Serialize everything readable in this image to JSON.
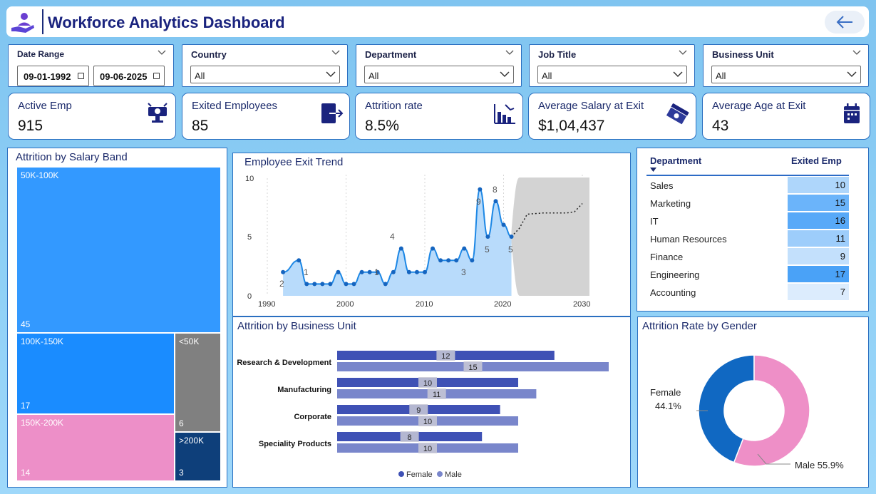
{
  "header": {
    "title": "Workforce Analytics Dashboard"
  },
  "filters": {
    "date_range": {
      "label": "Date Range",
      "start": "09-01-1992",
      "end": "09-06-2025"
    },
    "country": {
      "label": "Country",
      "value": "All"
    },
    "department": {
      "label": "Department",
      "value": "All"
    },
    "job_title": {
      "label": "Job Title",
      "value": "All"
    },
    "business_unit": {
      "label": "Business Unit",
      "value": "All"
    }
  },
  "kpis": [
    {
      "label": "Active Emp",
      "value": "915",
      "icon": "workstation-icon"
    },
    {
      "label": "Exited Employees",
      "value": "85",
      "icon": "exit-door-icon"
    },
    {
      "label": "Attrition rate",
      "value": "8.5%",
      "icon": "declining-chart-icon"
    },
    {
      "label": "Average Salary at Exit",
      "value": "$1,04,437",
      "icon": "money-stack-icon"
    },
    {
      "label": "Average Age at Exit",
      "value": "43",
      "icon": "calendar-icon"
    }
  ],
  "salary_band": {
    "title": "Attrition by Salary Band",
    "bands": [
      {
        "label": "50K-100K",
        "value": "45",
        "color": "#3399ff"
      },
      {
        "label": "100K-150K",
        "value": "17",
        "color": "#1a8cff"
      },
      {
        "label": "<50K",
        "value": "6",
        "color": "#808080"
      },
      {
        "label": "150K-200K",
        "value": "14",
        "color": "#ed8fc8"
      },
      {
        "label": ">200K",
        "value": "3",
        "color": "#0e3f7a"
      }
    ]
  },
  "exit_trend": {
    "title": "Employee Exit Trend",
    "y_ticks": [
      "10",
      "5",
      "0"
    ],
    "x_ticks": [
      "1990",
      "2000",
      "2010",
      "2020",
      "2030"
    ],
    "point_labels": [
      "2",
      "1",
      "1",
      "4",
      "3",
      "9",
      "8",
      "5",
      "5"
    ]
  },
  "business_unit": {
    "title": "Attrition by Business Unit",
    "legend": {
      "female": "Female",
      "male": "Male"
    },
    "colors": {
      "female": "#3f51b5",
      "male": "#7986cb"
    }
  },
  "department_table": {
    "header_dept": "Department",
    "header_exited": "Exited Emp",
    "rows": [
      {
        "name": "Sales",
        "value": "10",
        "color": "#aed6fb"
      },
      {
        "name": "Marketing",
        "value": "15",
        "color": "#6bb4fa"
      },
      {
        "name": "IT",
        "value": "16",
        "color": "#58a9f8"
      },
      {
        "name": "Human Resources",
        "value": "11",
        "color": "#9dcdfb"
      },
      {
        "name": "Finance",
        "value": "9",
        "color": "#c3e0fc"
      },
      {
        "name": "Engineering",
        "value": "17",
        "color": "#4aa2f7"
      },
      {
        "name": "Accounting",
        "value": "7",
        "color": "#dcecfd"
      }
    ]
  },
  "gender": {
    "title": "Attrition Rate by Gender",
    "female_label": "Female",
    "female_value": "44.1%",
    "male_label": "Male 55.9%",
    "colors": {
      "female": "#1068c2",
      "male": "#ee8fc7"
    }
  },
  "chart_data": [
    {
      "type": "line",
      "title": "Employee Exit Trend",
      "x": [
        1992,
        1994,
        1995,
        1996,
        1997,
        1998,
        1999,
        2000,
        2001,
        2002,
        2003,
        2004,
        2005,
        2006,
        2007,
        2008,
        2009,
        2010,
        2011,
        2012,
        2013,
        2014,
        2015,
        2016,
        2017,
        2018,
        2019,
        2020,
        2021
      ],
      "values": [
        2,
        3,
        1,
        1,
        1,
        1,
        2,
        1,
        1,
        2,
        2,
        2,
        1,
        2,
        4,
        2,
        2,
        2,
        4,
        3,
        3,
        3,
        4,
        3,
        9,
        5,
        8,
        6,
        5
      ],
      "forecast": {
        "x": [
          2021,
          2030
        ],
        "note": "forecast band"
      },
      "xlim": [
        1990,
        2030
      ],
      "ylim": [
        0,
        10
      ]
    },
    {
      "type": "bar",
      "title": "Attrition by Business Unit",
      "categories": [
        "Research & Development",
        "Manufacturing",
        "Corporate",
        "Speciality Products"
      ],
      "series": [
        {
          "name": "Female",
          "values": [
            12,
            10,
            9,
            8
          ]
        },
        {
          "name": "Male",
          "values": [
            15,
            11,
            10,
            10
          ]
        }
      ]
    },
    {
      "type": "pie",
      "title": "Attrition Rate by Gender",
      "categories": [
        "Female",
        "Male"
      ],
      "values": [
        44.1,
        55.9
      ]
    }
  ]
}
